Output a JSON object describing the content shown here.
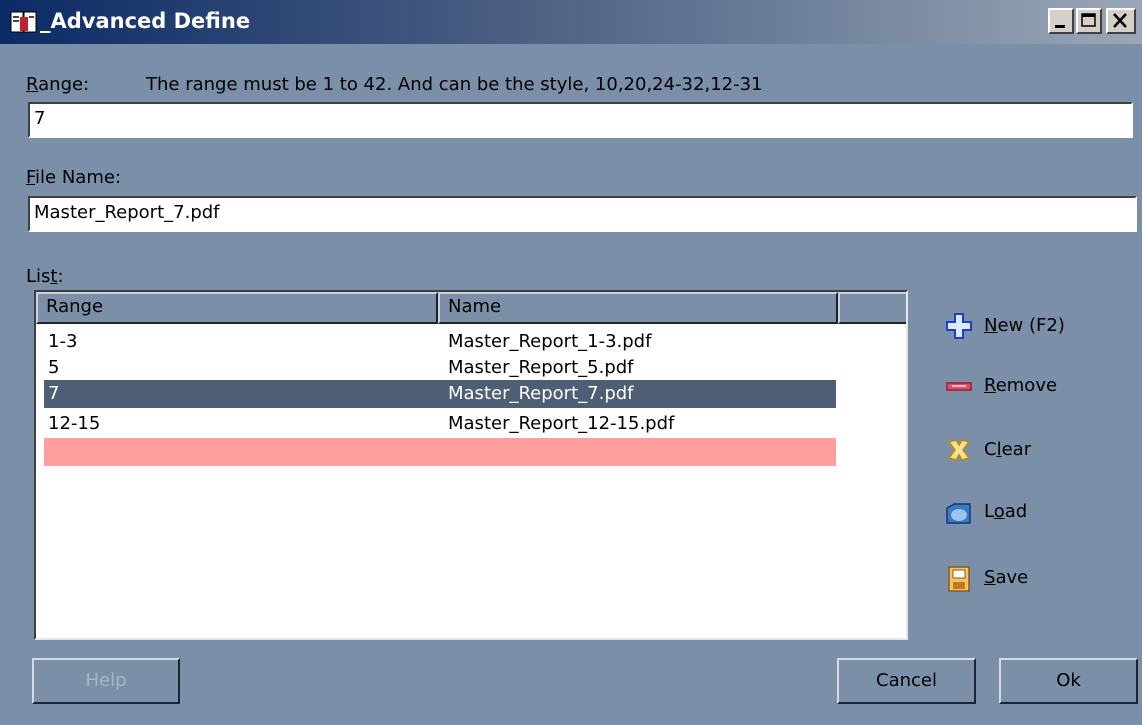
{
  "window": {
    "title": "_Advanced Define",
    "icons": {
      "app": "book-icon",
      "minimize": "minimize-icon",
      "maximize": "maximize-icon",
      "close": "close-icon"
    }
  },
  "range": {
    "label_key": "R",
    "label_rest": "ange:",
    "hint": "The range must be 1 to 42. And can be the style, 10,20,24-32,12-31",
    "value": "7"
  },
  "file_name": {
    "label_key": "F",
    "label_rest": "ile Name:",
    "value": "Master_Report_7.pdf"
  },
  "list": {
    "label_pre": "Lis",
    "label_key": "t",
    "label_post": ":",
    "columns": [
      "Range",
      "Name"
    ],
    "rows": [
      {
        "range": "1-3",
        "name": "Master_Report_1-3.pdf",
        "selected": false
      },
      {
        "range": "5",
        "name": "Master_Report_5.pdf",
        "selected": false
      },
      {
        "range": "7",
        "name": "Master_Report_7.pdf",
        "selected": true
      },
      {
        "range": "12-15",
        "name": "Master_Report_12-15.pdf",
        "selected": false
      }
    ],
    "new_row_color": "#ff9e9e",
    "selected_color": "#4d5e75"
  },
  "actions": {
    "new": {
      "key": "N",
      "rest": "ew (F2)",
      "icon": "plus-icon"
    },
    "remove": {
      "key": "R",
      "rest": "emove",
      "icon": "remove-icon"
    },
    "clear": {
      "pre": "C",
      "key": "l",
      "rest": "ear",
      "icon": "clear-icon"
    },
    "load": {
      "pre": "L",
      "key": "o",
      "rest": "ad",
      "icon": "load-icon"
    },
    "save": {
      "key": "S",
      "rest": "ave",
      "icon": "save-icon"
    }
  },
  "footer": {
    "help": "Help",
    "cancel": "Cancel",
    "ok": "Ok"
  },
  "colors": {
    "background": "#7b8fa9",
    "titlebar_start": "#0b2a66"
  }
}
